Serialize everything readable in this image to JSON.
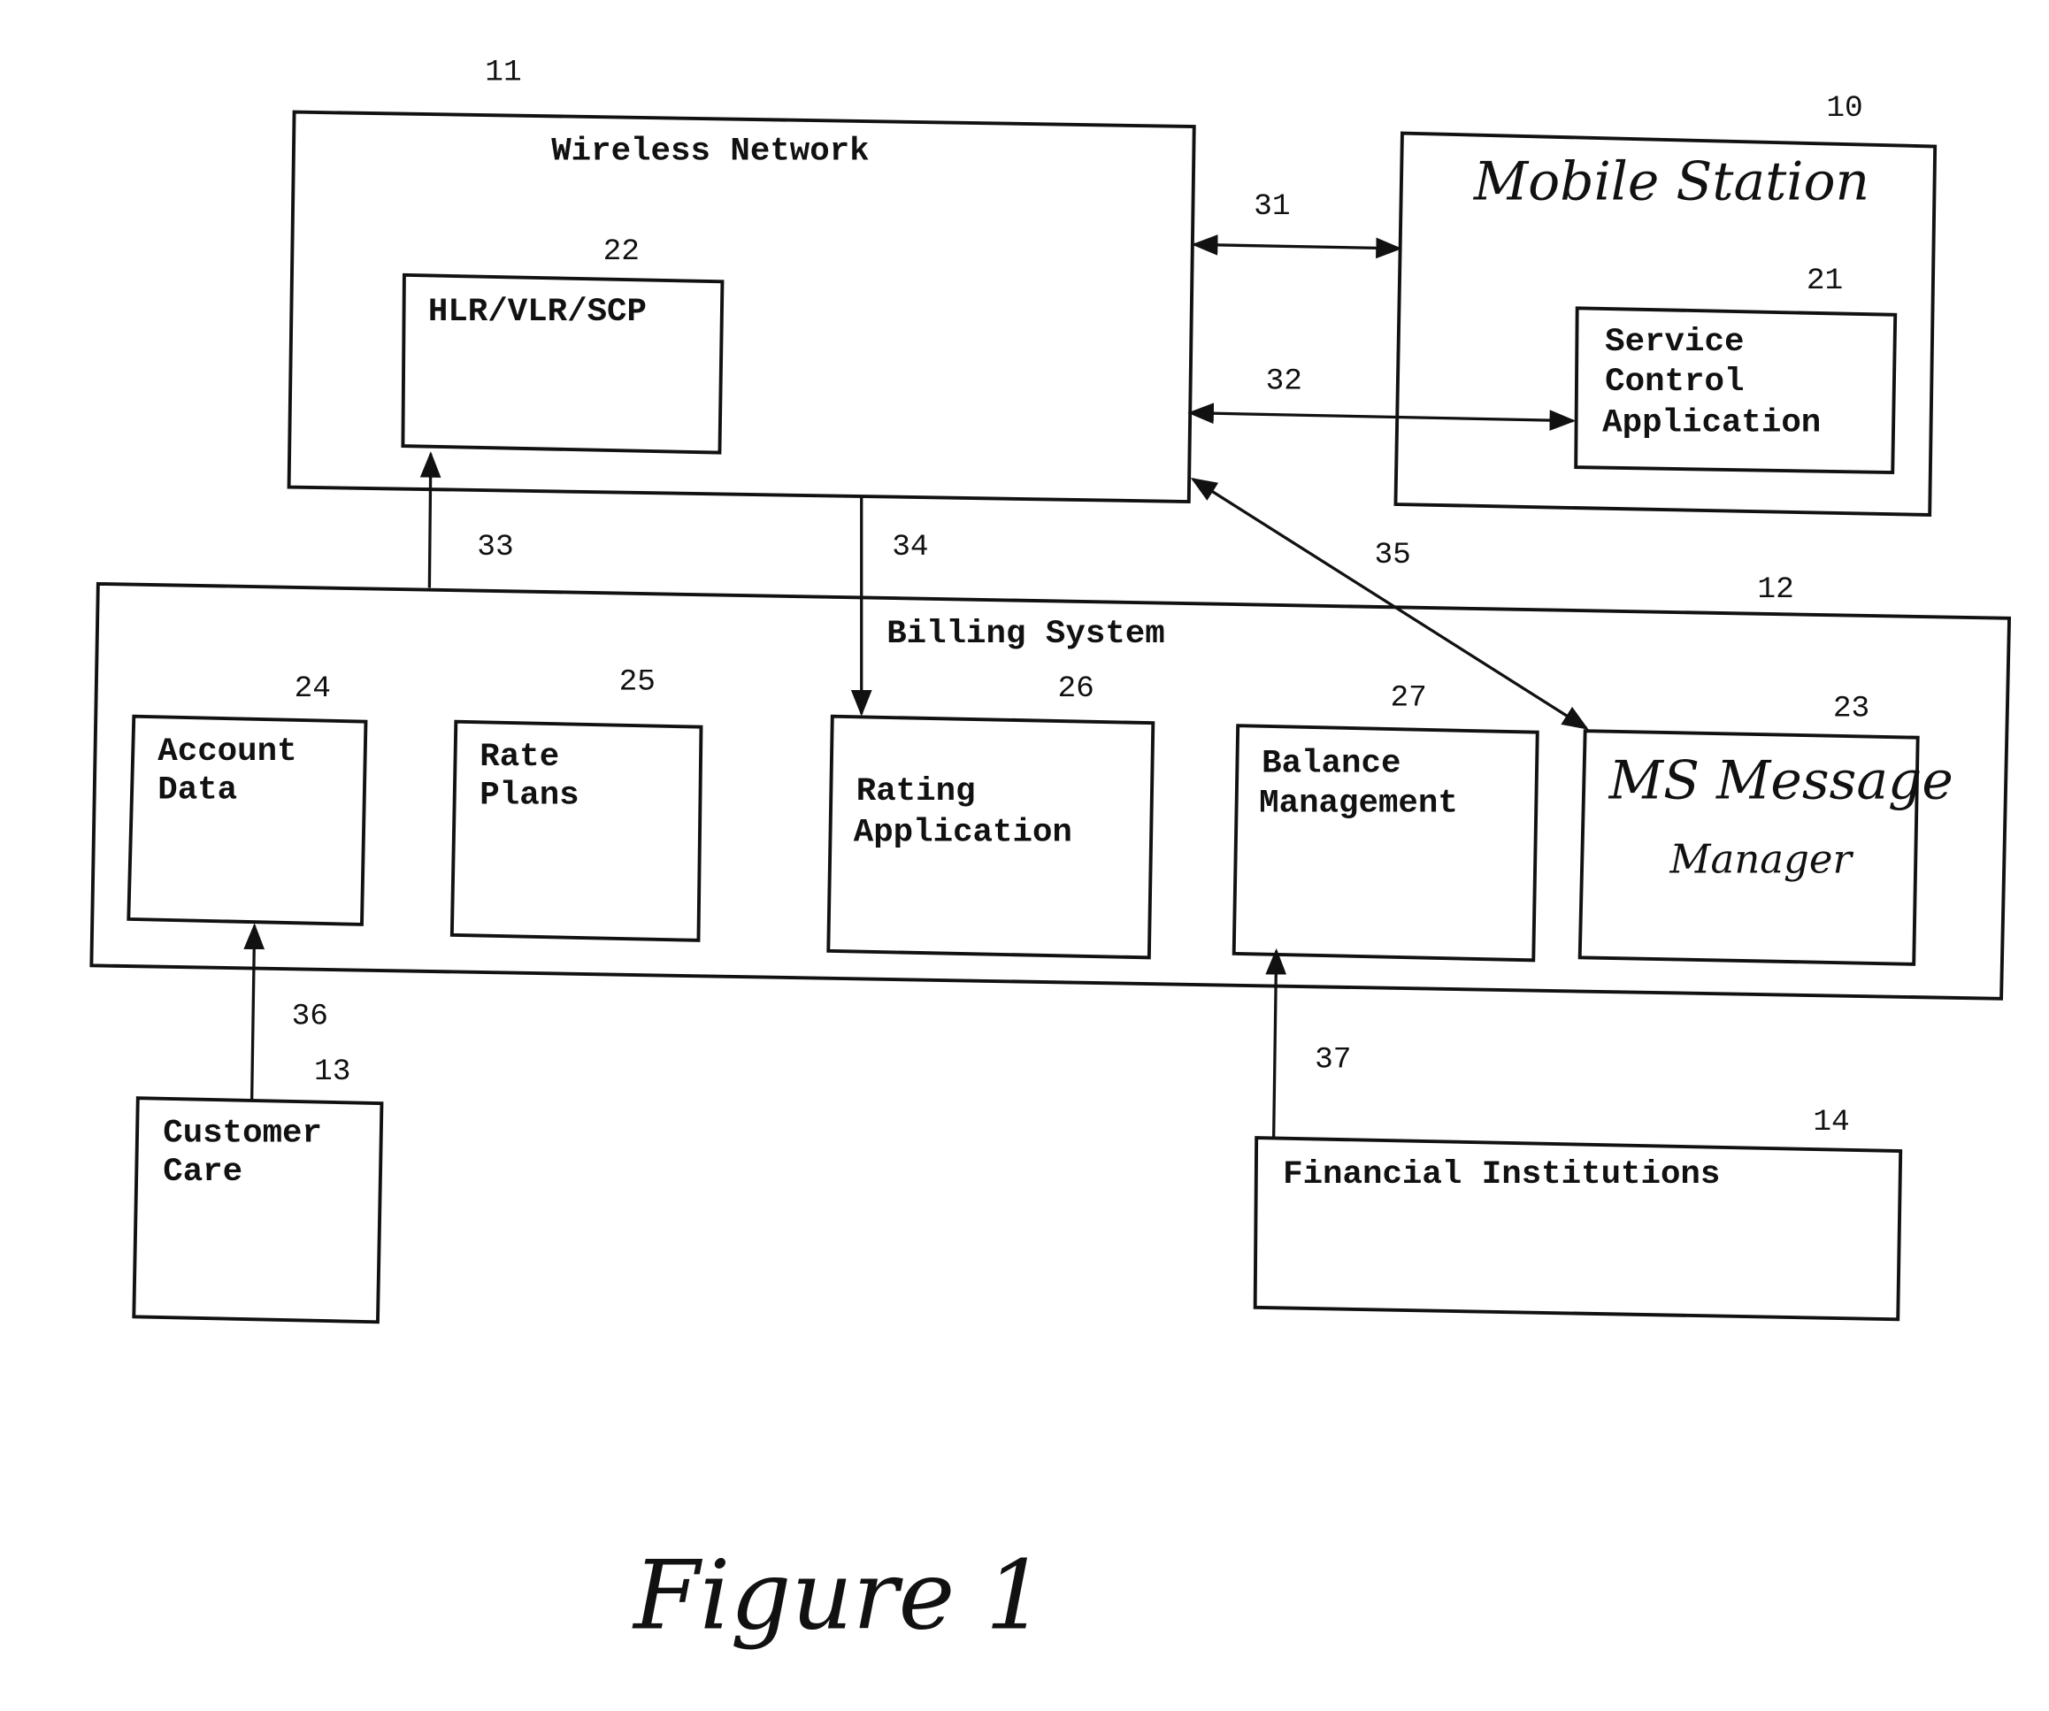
{
  "figure": {
    "caption": "Figure 1",
    "nodes": {
      "mobile_station": {
        "ref": "10",
        "title": "Mobile Station"
      },
      "wireless_network": {
        "ref": "11",
        "title": "Wireless Network"
      },
      "billing_system": {
        "ref": "12",
        "title": "Billing System"
      },
      "customer_care": {
        "ref": "13",
        "lines": [
          "Customer",
          "Care"
        ]
      },
      "financial_institutions": {
        "ref": "14",
        "title": "Financial Institutions"
      },
      "service_control_application": {
        "ref": "21",
        "lines": [
          "Service",
          "Control",
          "Application"
        ]
      },
      "hlr_vlr_scp": {
        "ref": "22",
        "title": "HLR/VLR/SCP"
      },
      "ms_message_manager": {
        "ref": "23",
        "lines": [
          "MS Message",
          "Manager"
        ]
      },
      "account_data": {
        "ref": "24",
        "lines": [
          "Account",
          "Data"
        ]
      },
      "rate_plans": {
        "ref": "25",
        "lines": [
          "Rate",
          "Plans"
        ]
      },
      "rating_application": {
        "ref": "26",
        "lines": [
          "Rating",
          "Application"
        ]
      },
      "balance_management": {
        "ref": "27",
        "lines": [
          "Balance",
          "Management"
        ]
      }
    },
    "connections": [
      {
        "ref": "31",
        "from": "Wireless Network",
        "to": "Mobile Station",
        "direction": "bidirectional"
      },
      {
        "ref": "32",
        "from": "Wireless Network",
        "to": "Service Control Application",
        "direction": "bidirectional"
      },
      {
        "ref": "33",
        "from": "Billing System",
        "to": "HLR/VLR/SCP",
        "direction": "forward"
      },
      {
        "ref": "34",
        "from": "Wireless Network",
        "to": "Rating Application",
        "direction": "forward"
      },
      {
        "ref": "35",
        "from": "Wireless Network",
        "to": "MS Message Manager",
        "direction": "bidirectional"
      },
      {
        "ref": "36",
        "from": "Customer Care",
        "to": "Account Data",
        "direction": "forward"
      },
      {
        "ref": "37",
        "from": "Financial Institutions",
        "to": "Balance Management",
        "direction": "forward"
      }
    ]
  }
}
